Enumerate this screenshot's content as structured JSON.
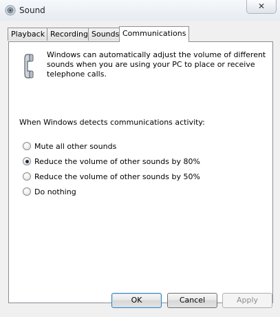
{
  "window": {
    "title": "Sound",
    "close_glyph": "✕"
  },
  "tabs": [
    {
      "label": "Playback"
    },
    {
      "label": "Recording"
    },
    {
      "label": "Sounds"
    },
    {
      "label": "Communications",
      "active": true
    }
  ],
  "communications": {
    "description": "Windows can automatically adjust the volume of different sounds when you are using your PC to place or receive telephone calls.",
    "prompt": "When Windows detects communications activity:",
    "options": [
      {
        "label": "Mute all other sounds",
        "checked": false
      },
      {
        "label": "Reduce the volume of other sounds by 80%",
        "checked": true
      },
      {
        "label": "Reduce the volume of other sounds by 50%",
        "checked": false
      },
      {
        "label": "Do nothing",
        "checked": false
      }
    ]
  },
  "buttons": {
    "ok": "OK",
    "cancel": "Cancel",
    "apply": "Apply"
  },
  "icons": {
    "app": "speaker-icon",
    "phone": "telephone-handset-icon",
    "close": "close-icon"
  }
}
